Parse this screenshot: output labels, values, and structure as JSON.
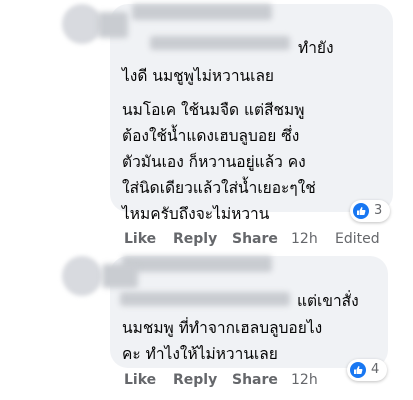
{
  "comments": [
    {
      "lines": [
        "ทำยัง",
        "ไงดี นมชูพูไม่หวานเลย",
        "นมโอเค ใช้นมจืด แต่สีชมพู",
        "ต้องใช้น้ำแดงเฮบลูบอย ซึ่ง",
        "ตัวมันเอง ก็หวานอยู่แล้ว คง",
        "ใส่นิดเดียวแล้วใส่น้ำเยอะๆใช่",
        "ไหมครับถึงจะไม่หวาน"
      ],
      "reaction_count": "3",
      "actions": {
        "like": "Like",
        "reply": "Reply",
        "share": "Share",
        "time": "12h",
        "edited": "Edited"
      }
    },
    {
      "lines": [
        "แต่เขาสั่ง",
        "นมชมพู ที่ทำจากเฮลบลูบอยไง",
        "คะ ทำไงให้ไม่หวานเลย"
      ],
      "reaction_count": "4",
      "actions": {
        "like": "Like",
        "reply": "Reply",
        "share": "Share",
        "time": "12h"
      }
    }
  ],
  "colors": {
    "bubble": "#f0f2f5",
    "meta": "#65676b",
    "like_blue": "#1877f2"
  },
  "icons": {
    "reaction": "thumbs-up-icon"
  }
}
